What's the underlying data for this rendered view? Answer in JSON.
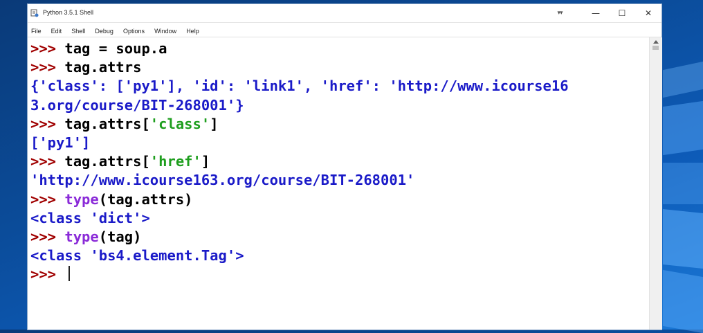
{
  "window": {
    "title": "Python 3.5.1 Shell",
    "controls": {
      "grip": "▾▾",
      "minimize": "—",
      "maximize": "☐",
      "close": "✕"
    }
  },
  "menu": [
    "File",
    "Edit",
    "Shell",
    "Debug",
    "Options",
    "Window",
    "Help"
  ],
  "shell": {
    "prompt": ">>>",
    "lines": [
      {
        "kind": "input",
        "parts": [
          {
            "t": "cmd",
            "v": "tag = soup.a"
          }
        ]
      },
      {
        "kind": "input",
        "parts": [
          {
            "t": "cmd",
            "v": "tag.attrs"
          }
        ]
      },
      {
        "kind": "output",
        "parts": [
          {
            "t": "out",
            "v": "{'class': ['py1'], 'id': 'link1', 'href': 'http://www.icourse16"
          }
        ]
      },
      {
        "kind": "output",
        "parts": [
          {
            "t": "out",
            "v": "3.org/course/BIT-268001'}"
          }
        ]
      },
      {
        "kind": "input",
        "parts": [
          {
            "t": "cmd",
            "v": "tag.attrs["
          },
          {
            "t": "str",
            "v": "'class'"
          },
          {
            "t": "cmd",
            "v": "]"
          }
        ]
      },
      {
        "kind": "output",
        "parts": [
          {
            "t": "out",
            "v": "['py1']"
          }
        ]
      },
      {
        "kind": "input",
        "parts": [
          {
            "t": "cmd",
            "v": "tag.attrs["
          },
          {
            "t": "str",
            "v": "'href'"
          },
          {
            "t": "cmd",
            "v": "]"
          }
        ]
      },
      {
        "kind": "output",
        "parts": [
          {
            "t": "out",
            "v": "'http://www.icourse163.org/course/BIT-268001'"
          }
        ]
      },
      {
        "kind": "input",
        "parts": [
          {
            "t": "kw",
            "v": "type"
          },
          {
            "t": "cmd",
            "v": "(tag.attrs)"
          }
        ]
      },
      {
        "kind": "output",
        "parts": [
          {
            "t": "out",
            "v": "<class 'dict'>"
          }
        ]
      },
      {
        "kind": "input",
        "parts": [
          {
            "t": "kw",
            "v": "type"
          },
          {
            "t": "cmd",
            "v": "(tag)"
          }
        ]
      },
      {
        "kind": "output",
        "parts": [
          {
            "t": "out",
            "v": "<class 'bs4.element.Tag'>"
          }
        ]
      },
      {
        "kind": "current",
        "parts": []
      }
    ]
  },
  "colors": {
    "prompt": "#a00000",
    "output": "#1a1ac8",
    "string": "#1e9e1e",
    "builtin": "#8a2ad8",
    "desktop": "#0b4c9a"
  },
  "icons": {
    "app": "python-idle-icon",
    "scroll_up": "scroll-up-arrow-icon"
  }
}
